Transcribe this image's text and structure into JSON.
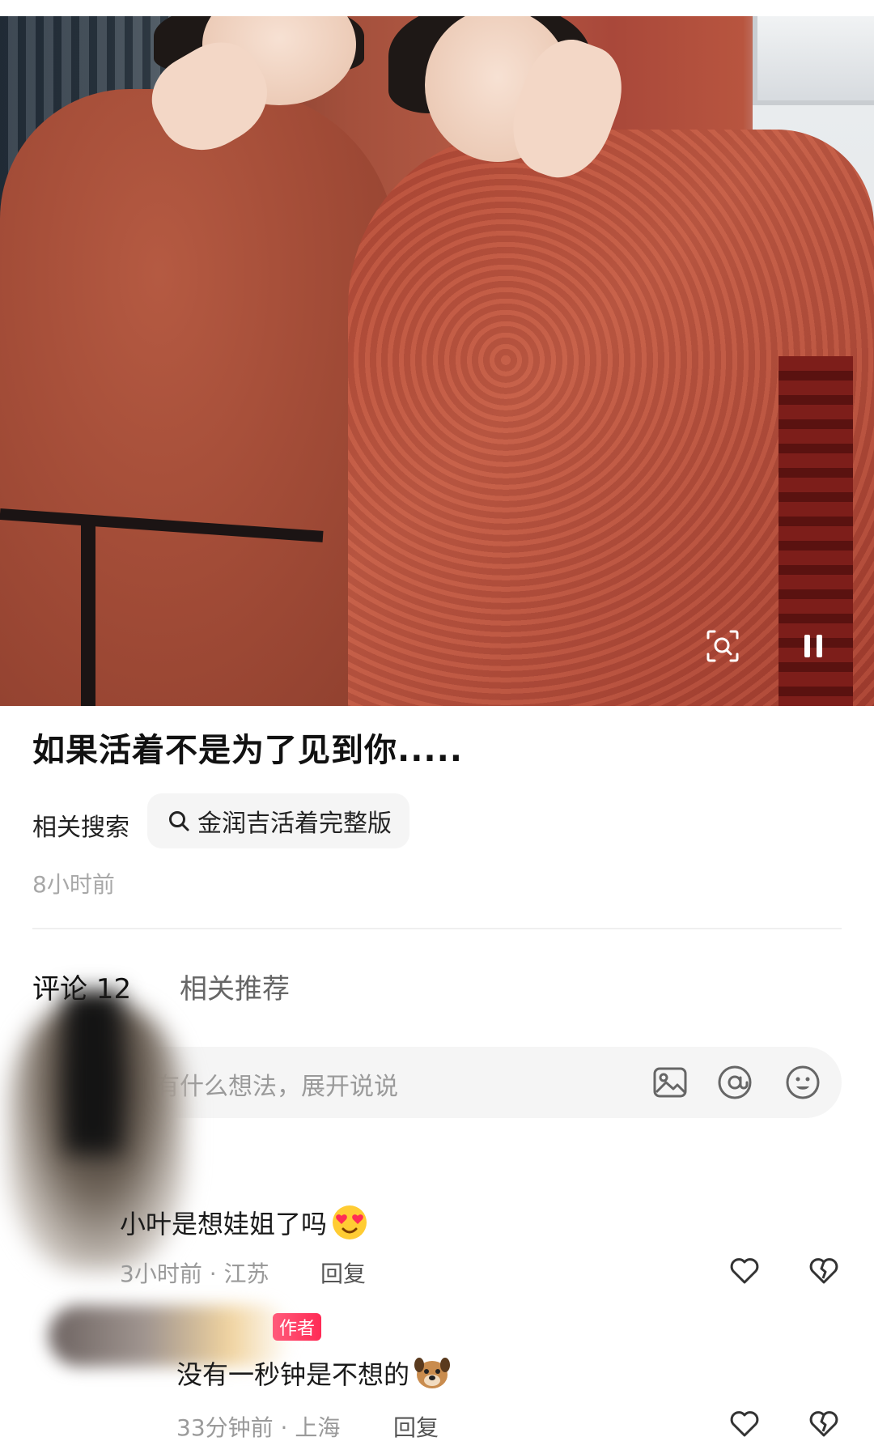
{
  "post": {
    "title": "如果活着不是为了见到你.....",
    "related_search_label": "相关搜索",
    "related_search_query": "金润吉活着完整版",
    "time": "8小时前"
  },
  "media": {
    "lens_icon": "image-search-icon",
    "pause_icon": "pause-icon"
  },
  "tabs": {
    "comments": "评论 12",
    "related": "相关推荐"
  },
  "comment_input": {
    "placeholder": "有什么想法，展开说说",
    "icons": [
      "image-icon",
      "at-icon",
      "emoji-icon"
    ]
  },
  "comments": [
    {
      "text": "小叶是想娃姐了吗",
      "emoji": "heart-eyes-emoji",
      "meta": "3小时前 · 江苏",
      "reply": "回复"
    },
    {
      "author_badge": "作者",
      "text": "没有一秒钟是不想的",
      "emoji": "dog-emoji",
      "meta": "33分钟前 · 上海",
      "reply": "回复"
    }
  ]
}
